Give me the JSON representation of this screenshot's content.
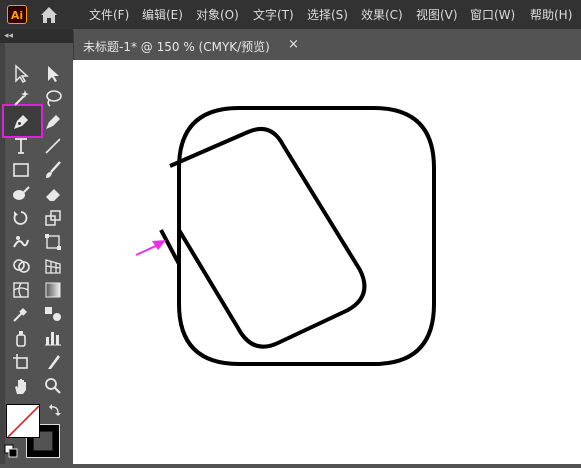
{
  "app": {
    "logo_text": "Ai",
    "accent": "#ff9a00"
  },
  "menu": [
    {
      "label": "文件(F)"
    },
    {
      "label": "编辑(E)"
    },
    {
      "label": "对象(O)"
    },
    {
      "label": "文字(T)"
    },
    {
      "label": "选择(S)"
    },
    {
      "label": "效果(C)"
    },
    {
      "label": "视图(V)"
    },
    {
      "label": "窗口(W)"
    },
    {
      "label": "帮助(H)"
    }
  ],
  "toolbar": {
    "collapse_glyph": "◂◂",
    "tools": [
      "selection-tool",
      "direct-selection-tool",
      "magic-wand-tool",
      "lasso-tool",
      "pen-tool",
      "curvature-tool",
      "type-tool",
      "line-segment-tool",
      "rectangle-tool",
      "paintbrush-tool",
      "shaper-tool",
      "eraser-tool",
      "rotate-tool",
      "scale-tool",
      "warp-tool",
      "free-transform-tool",
      "shape-builder-tool",
      "perspective-grid-tool",
      "mesh-tool",
      "gradient-tool",
      "eyedropper-tool",
      "blend-tool",
      "symbol-sprayer-tool",
      "column-graph-tool",
      "artboard-tool",
      "slice-tool",
      "hand-tool",
      "zoom-tool"
    ],
    "active_tool": "pen-tool",
    "highlight_color": "#e020e0"
  },
  "document_tab": {
    "title": "未标题-1* @ 150 % (CMYK/预览)",
    "close_glyph": "×"
  },
  "annotation": {
    "arrow_color": "#e830e8"
  }
}
